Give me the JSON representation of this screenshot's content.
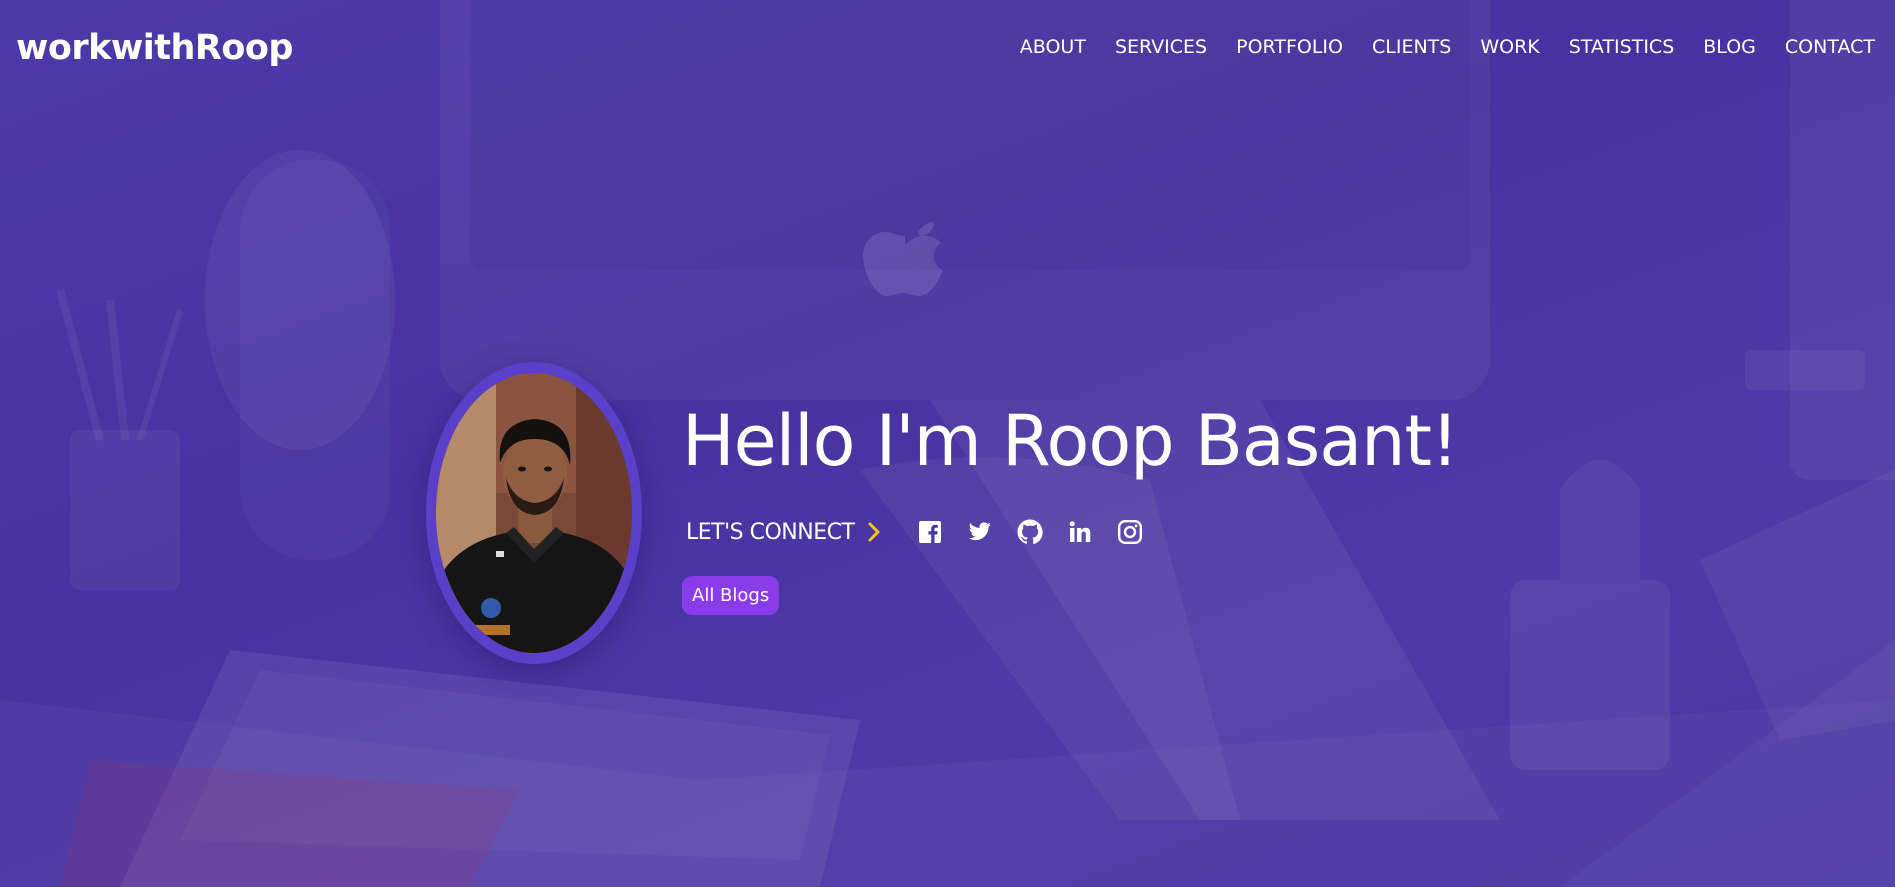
{
  "nav": {
    "brand": "workwithRoop",
    "items": [
      {
        "label": "ABOUT"
      },
      {
        "label": "SERVICES"
      },
      {
        "label": "PORTFOLIO"
      },
      {
        "label": "CLIENTS"
      },
      {
        "label": "WORK"
      },
      {
        "label": "STATISTICS"
      },
      {
        "label": "BLOG"
      },
      {
        "label": "CONTACT"
      }
    ]
  },
  "hero": {
    "headline": "Hello I'm Roop Basant!",
    "connect_label": "LET'S CONNECT",
    "socials": [
      {
        "icon": "facebook-icon"
      },
      {
        "icon": "twitter-icon"
      },
      {
        "icon": "github-icon"
      },
      {
        "icon": "linkedin-icon"
      },
      {
        "icon": "instagram-icon"
      }
    ],
    "blogs_button": "All Blogs"
  },
  "colors": {
    "background": "#4a36a4",
    "avatar_ring": "#5a3fc9",
    "button": "#8a3bea",
    "chevron": "#f5c518",
    "text": "#ffffff"
  }
}
